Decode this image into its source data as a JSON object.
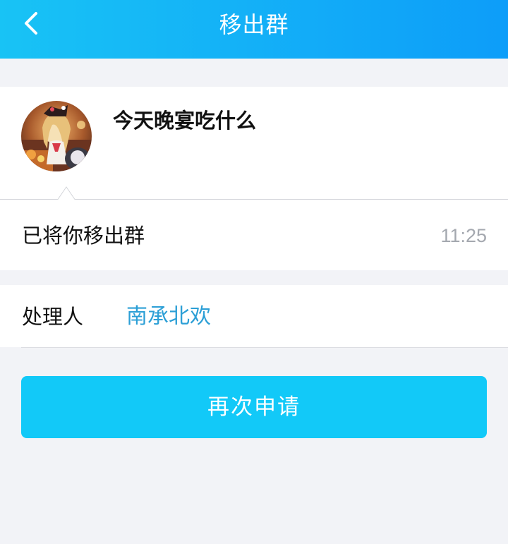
{
  "header": {
    "title": "移出群",
    "back_icon": "chevron-left-icon"
  },
  "group": {
    "name": "今天晚宴吃什么",
    "avatar_icon": "group-avatar"
  },
  "notice": {
    "message": "已将你移出群",
    "time": "11:25"
  },
  "handler": {
    "label": "处理人",
    "name": "南承北欢"
  },
  "actions": {
    "reapply_label": "再次申请"
  },
  "colors": {
    "header_gradient_start": "#18c3f5",
    "header_gradient_end": "#0d9df9",
    "button": "#12c9f8",
    "link": "#2c9fd6",
    "background": "#f2f3f7"
  }
}
